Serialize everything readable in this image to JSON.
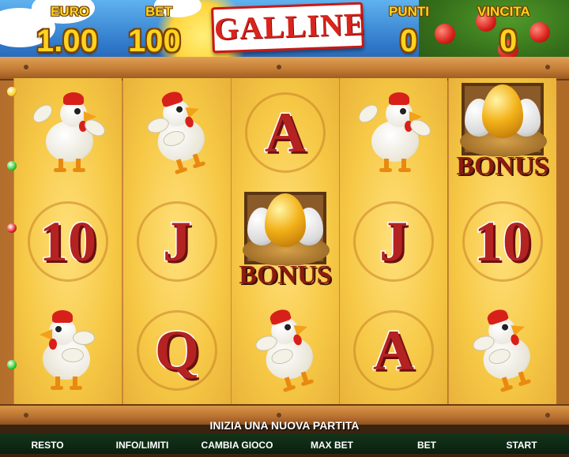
{
  "game": {
    "title": "GALLINE"
  },
  "hud": {
    "euro_label": "EURO",
    "euro_value": "1.00",
    "bet_label": "BET",
    "bet_value": "100",
    "punti_label": "PUNTI",
    "punti_value": "0",
    "vincita_label": "VINCITA",
    "vincita_value": "0"
  },
  "reels": [
    [
      "chicken-happy",
      "10",
      "chicken-walking"
    ],
    [
      "chicken-scared",
      "J",
      "Q"
    ],
    [
      "A",
      "bonus-egg",
      "chicken-scared"
    ],
    [
      "chicken-happy",
      "J",
      "A"
    ],
    [
      "bonus-egg",
      "10",
      "chicken-scared"
    ]
  ],
  "bonus": {
    "label": "BONUS"
  },
  "payline_gem_colors": [
    "#ffd21e",
    "#2ad02a",
    "#e02020",
    "#e02020",
    "#2ad02a"
  ],
  "message": "INIZIA UNA NUOVA PARTITA",
  "buttons": {
    "resto": "RESTO",
    "info": "INFO/LIMITI",
    "cambia": "CAMBIA GIOCO",
    "maxbet": "MAX BET",
    "bet": "BET",
    "start": "START"
  }
}
